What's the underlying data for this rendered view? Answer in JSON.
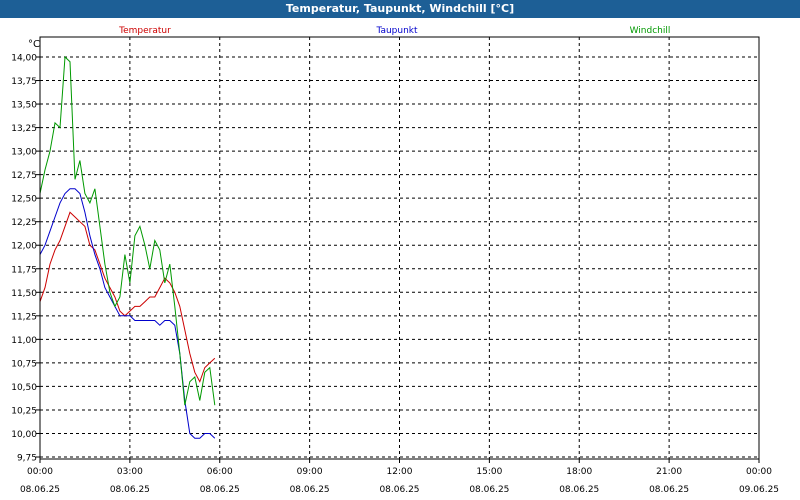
{
  "window": {
    "title": "Temperatur, Taupunkt, Windchill [°C]"
  },
  "colors": {
    "titlebar": "#1d5f96",
    "temperatur": "#cc0000",
    "taupunkt": "#0000cc",
    "windchill": "#009900"
  },
  "chart_data": {
    "type": "line",
    "title": "Temperatur, Taupunkt, Windchill [°C]",
    "ylabel": "°C",
    "xlabel": "",
    "xlim": [
      "2025-06-08 00:00",
      "2025-06-09 00:00"
    ],
    "ylim": [
      9.75,
      14.0
    ],
    "grid": true,
    "legend_position": "top",
    "y_ticks": [
      "14,00",
      "13,75",
      "13,50",
      "13,25",
      "13,00",
      "12,75",
      "12,50",
      "12,25",
      "12,00",
      "11,75",
      "11,50",
      "11,25",
      "11,00",
      "10,75",
      "10,50",
      "10,25",
      "10,00",
      "9,75"
    ],
    "x_ticks": [
      {
        "time": "00:00",
        "date": "08.06.25"
      },
      {
        "time": "03:00",
        "date": "08.06.25"
      },
      {
        "time": "06:00",
        "date": "08.06.25"
      },
      {
        "time": "09:00",
        "date": "08.06.25"
      },
      {
        "time": "12:00",
        "date": "08.06.25"
      },
      {
        "time": "15:00",
        "date": "08.06.25"
      },
      {
        "time": "18:00",
        "date": "08.06.25"
      },
      {
        "time": "21:00",
        "date": "08.06.25"
      },
      {
        "time": "00:00",
        "date": "09.06.25"
      }
    ],
    "series": [
      {
        "name": "Temperatur",
        "color": "#cc0000",
        "points": [
          [
            "00:00",
            11.4
          ],
          [
            "00:10",
            11.55
          ],
          [
            "00:20",
            11.8
          ],
          [
            "00:30",
            11.95
          ],
          [
            "00:40",
            12.05
          ],
          [
            "00:50",
            12.2
          ],
          [
            "01:00",
            12.35
          ],
          [
            "01:10",
            12.3
          ],
          [
            "01:20",
            12.25
          ],
          [
            "01:30",
            12.2
          ],
          [
            "01:40",
            12.0
          ],
          [
            "01:50",
            11.95
          ],
          [
            "02:00",
            11.8
          ],
          [
            "02:10",
            11.65
          ],
          [
            "02:20",
            11.55
          ],
          [
            "02:30",
            11.45
          ],
          [
            "02:40",
            11.3
          ],
          [
            "02:50",
            11.25
          ],
          [
            "03:00",
            11.3
          ],
          [
            "03:10",
            11.35
          ],
          [
            "03:20",
            11.35
          ],
          [
            "03:30",
            11.4
          ],
          [
            "03:40",
            11.45
          ],
          [
            "03:50",
            11.45
          ],
          [
            "04:00",
            11.55
          ],
          [
            "04:10",
            11.65
          ],
          [
            "04:20",
            11.6
          ],
          [
            "04:30",
            11.5
          ],
          [
            "04:40",
            11.35
          ],
          [
            "04:50",
            11.1
          ],
          [
            "05:00",
            10.85
          ],
          [
            "05:10",
            10.65
          ],
          [
            "05:20",
            10.55
          ],
          [
            "05:30",
            10.7
          ],
          [
            "05:40",
            10.75
          ],
          [
            "05:50",
            10.8
          ]
        ]
      },
      {
        "name": "Taupunkt",
        "color": "#0000cc",
        "points": [
          [
            "00:00",
            11.9
          ],
          [
            "00:10",
            12.0
          ],
          [
            "00:20",
            12.15
          ],
          [
            "00:30",
            12.3
          ],
          [
            "00:40",
            12.45
          ],
          [
            "00:50",
            12.55
          ],
          [
            "01:00",
            12.6
          ],
          [
            "01:10",
            12.6
          ],
          [
            "01:20",
            12.55
          ],
          [
            "01:30",
            12.35
          ],
          [
            "01:40",
            12.1
          ],
          [
            "01:50",
            11.9
          ],
          [
            "02:00",
            11.75
          ],
          [
            "02:10",
            11.55
          ],
          [
            "02:20",
            11.45
          ],
          [
            "02:30",
            11.35
          ],
          [
            "02:40",
            11.25
          ],
          [
            "02:50",
            11.25
          ],
          [
            "03:00",
            11.25
          ],
          [
            "03:10",
            11.2
          ],
          [
            "03:20",
            11.2
          ],
          [
            "03:30",
            11.2
          ],
          [
            "03:40",
            11.2
          ],
          [
            "03:50",
            11.2
          ],
          [
            "04:00",
            11.15
          ],
          [
            "04:10",
            11.2
          ],
          [
            "04:20",
            11.2
          ],
          [
            "04:30",
            11.15
          ],
          [
            "04:40",
            10.85
          ],
          [
            "04:50",
            10.35
          ],
          [
            "05:00",
            10.0
          ],
          [
            "05:10",
            9.95
          ],
          [
            "05:20",
            9.95
          ],
          [
            "05:30",
            10.0
          ],
          [
            "05:40",
            10.0
          ],
          [
            "05:50",
            9.95
          ]
        ]
      },
      {
        "name": "Windchill",
        "color": "#009900",
        "points": [
          [
            "00:00",
            12.55
          ],
          [
            "00:10",
            12.8
          ],
          [
            "00:20",
            13.0
          ],
          [
            "00:30",
            13.3
          ],
          [
            "00:40",
            13.25
          ],
          [
            "00:50",
            14.0
          ],
          [
            "01:00",
            13.95
          ],
          [
            "01:10",
            12.7
          ],
          [
            "01:20",
            12.9
          ],
          [
            "01:30",
            12.55
          ],
          [
            "01:40",
            12.45
          ],
          [
            "01:50",
            12.6
          ],
          [
            "02:00",
            12.2
          ],
          [
            "02:10",
            11.8
          ],
          [
            "02:20",
            11.5
          ],
          [
            "02:30",
            11.35
          ],
          [
            "02:40",
            11.45
          ],
          [
            "02:50",
            11.9
          ],
          [
            "03:00",
            11.6
          ],
          [
            "03:10",
            12.1
          ],
          [
            "03:20",
            12.2
          ],
          [
            "03:30",
            12.0
          ],
          [
            "03:40",
            11.75
          ],
          [
            "03:50",
            12.05
          ],
          [
            "04:00",
            11.95
          ],
          [
            "04:10",
            11.6
          ],
          [
            "04:20",
            11.8
          ],
          [
            "04:30",
            11.35
          ],
          [
            "04:40",
            10.85
          ],
          [
            "04:50",
            10.3
          ],
          [
            "05:00",
            10.55
          ],
          [
            "05:10",
            10.6
          ],
          [
            "05:20",
            10.35
          ],
          [
            "05:30",
            10.65
          ],
          [
            "05:40",
            10.7
          ],
          [
            "05:50",
            10.3
          ]
        ]
      }
    ]
  }
}
